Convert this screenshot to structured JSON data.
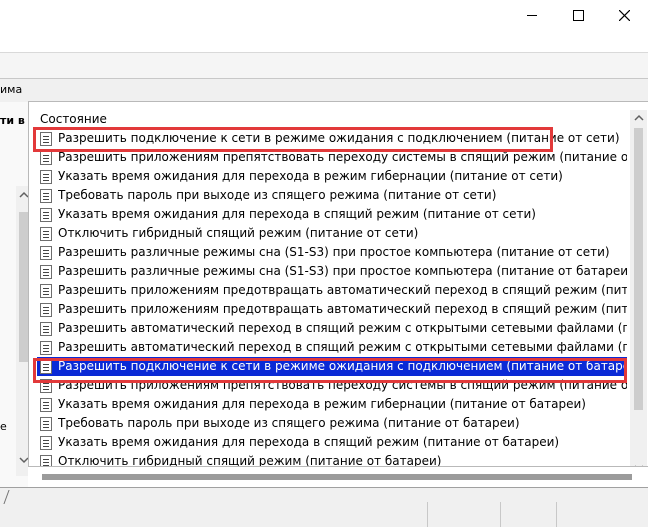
{
  "window": {
    "minimize_label": "—",
    "maximize_label": "☐",
    "close_label": "✕"
  },
  "band": {
    "text": "има"
  },
  "left_panel": {
    "bold_text": "ти в",
    "text2": "е"
  },
  "list": {
    "column_header": "Состояние",
    "selected_index": 12,
    "items": [
      "Разрешить подключение к сети в режиме ожидания с подключением (питание от сети)",
      "Разрешить приложениям препятствовать переходу системы в спящий режим (питание от сети)",
      "Указать время ожидания для перехода в режим гибернации (питание от сети)",
      "Требовать пароль при выходе из спящего режима (питание от сети)",
      "Указать время ожидания для перехода в спящий режим (питание от сети)",
      "Отключить гибридный спящий режим (питание от сети)",
      "Разрешить различные режимы сна (S1-S3) при простое компьютера (питание от сети)",
      "Разрешить различные режимы сна (S1-S3) при простое компьютера (питание от батареи)",
      "Разрешить приложениям предотвращать автоматический переход в спящий режим (питание от сети)",
      "Разрешить приложениям предотвращать автоматический переход в спящий режим (питание от батар...",
      "Разрешить автоматический переход в спящий режим с открытыми сетевыми файлами (питание от се...",
      "Разрешить автоматический переход в спящий режим с открытыми сетевыми файлами (питание от бат...",
      "Разрешить подключение к сети в режиме ожидания с подключением (питание от батареи)",
      "Разрешить приложениям препятствовать переходу системы в спящий режим (питание от батареи)",
      "Указать время ожидания для перехода в режим гибернации (питание от батареи)",
      "Требовать пароль при выходе из спящего режима (питание от батареи)",
      "Указать время ожидания для перехода в спящий режим (питание от батареи)",
      "Отключить гибридный спящий режим (питание от батареи)"
    ]
  },
  "colors": {
    "selection": "#0a2ad6",
    "highlight_box": "#e2393a"
  },
  "icons": {
    "list_item": "policy-setting-icon",
    "scroll_up": "chevron-up-icon",
    "scroll_down": "chevron-down-icon"
  }
}
